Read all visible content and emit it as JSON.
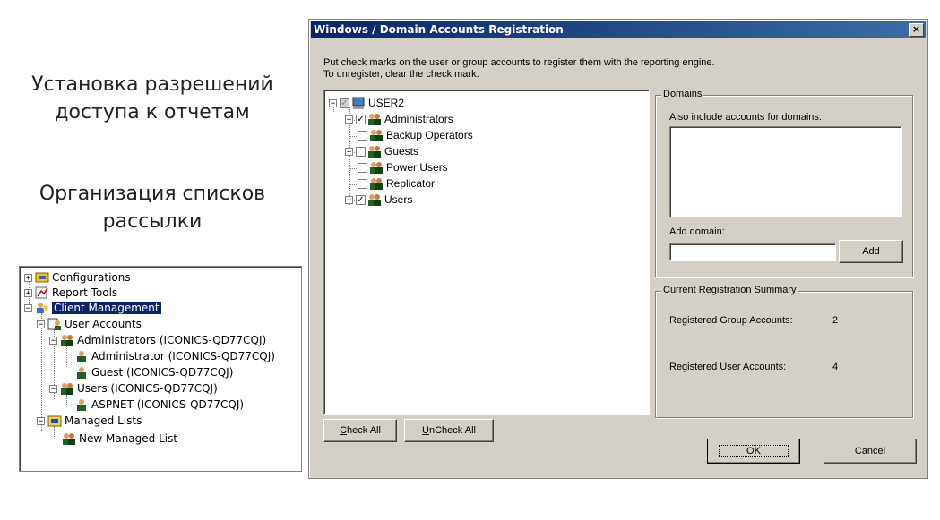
{
  "headings": {
    "permissions_line1": "Установка разрешений",
    "permissions_line2": "доступа к отчетам",
    "mailing_line1": "Организация списков",
    "mailing_line2": "рассылки"
  },
  "left_tree": [
    {
      "label": "Configurations",
      "icon": "configurations-icon",
      "expander": "+"
    },
    {
      "label": "Report Tools",
      "icon": "report-tools-icon",
      "expander": "+"
    },
    {
      "label": "Client Management",
      "icon": "client-management-icon",
      "expander": "-",
      "selected": true
    },
    {
      "label": "User Accounts",
      "icon": "user-accounts-icon",
      "expander": "-"
    },
    {
      "label": "Administrators (ICONICS-QD77CQJ)",
      "icon": "group-icon",
      "expander": "-"
    },
    {
      "label": "Administrator (ICONICS-QD77CQJ)",
      "icon": "user-icon"
    },
    {
      "label": "Guest (ICONICS-QD77CQJ)",
      "icon": "user-icon"
    },
    {
      "label": "Users (ICONICS-QD77CQJ)",
      "icon": "group-icon",
      "expander": "-"
    },
    {
      "label": "ASPNET (ICONICS-QD77CQJ)",
      "icon": "user-icon"
    },
    {
      "label": "Managed Lists",
      "icon": "managed-lists-icon",
      "expander": "-"
    },
    {
      "label": "New Managed List",
      "icon": "group-icon"
    }
  ],
  "dialog": {
    "title": "Windows / Domain Accounts Registration",
    "close": "×",
    "instructions_line1": "Put check marks on the user or group accounts to register them with the reporting engine.",
    "instructions_line2": "To unregister, clear the check mark.",
    "tree_root": "USER2",
    "tree_items": [
      {
        "label": "Administrators",
        "checked": true,
        "expander": "+"
      },
      {
        "label": "Backup Operators",
        "checked": false
      },
      {
        "label": "Guests",
        "checked": false,
        "expander": "+"
      },
      {
        "label": "Power Users",
        "checked": false
      },
      {
        "label": "Replicator",
        "checked": false
      },
      {
        "label": "Users",
        "checked": true,
        "expander": "+"
      }
    ],
    "domains": {
      "group_label": "Domains",
      "include_label": "Also include accounts for domains:",
      "add_domain_label": "Add domain:",
      "add_domain_value": "",
      "add_button": "Add"
    },
    "summary": {
      "group_label": "Current Registration Summary",
      "group_accounts_label": "Registered Group Accounts:",
      "group_accounts_value": "2",
      "user_accounts_label": "Registered User Accounts:",
      "user_accounts_value": "4"
    },
    "buttons": {
      "check_all_mnemonic": "C",
      "check_all_rest": "heck All",
      "uncheck_all_mnemonic": "U",
      "uncheck_all_rest": "nCheck All",
      "ok": "OK",
      "cancel": "Cancel"
    }
  },
  "colors": {
    "dialog_bg": "#d4d0c8",
    "title_start": "#0a246a",
    "title_end": "#3a6ea5",
    "selection": "#0a246a",
    "check": "#000000"
  }
}
